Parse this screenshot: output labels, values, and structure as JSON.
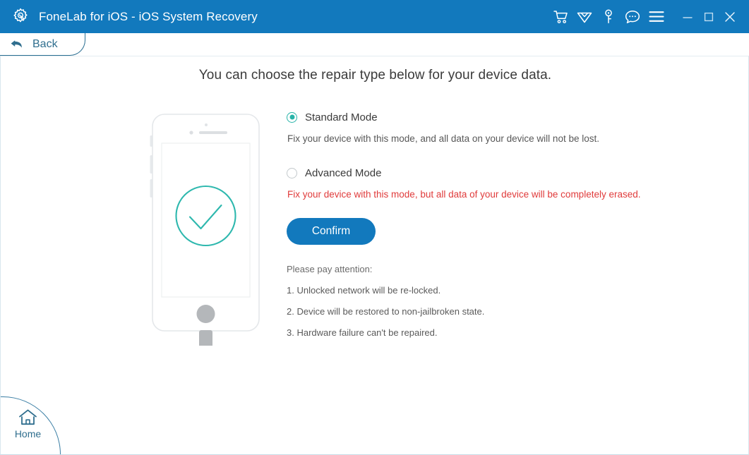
{
  "titlebar": {
    "app_icon": "gear-wrench-icon",
    "title": "FoneLab for iOS - iOS System Recovery",
    "background_color": "#1279bd",
    "actions": [
      {
        "name": "cart-icon",
        "label": "Shopping Cart"
      },
      {
        "name": "diamond-icon",
        "label": "Upgrade"
      },
      {
        "name": "key-icon",
        "label": "Register"
      },
      {
        "name": "chat-icon",
        "label": "Support"
      },
      {
        "name": "menu-icon",
        "label": "Menu"
      }
    ],
    "window_controls": [
      {
        "name": "minimize-icon",
        "label": "Minimize"
      },
      {
        "name": "maximize-icon",
        "label": "Maximize"
      },
      {
        "name": "close-icon",
        "label": "Close"
      }
    ]
  },
  "navigation": {
    "back_label": "Back",
    "back_icon": "back-arrow-icon",
    "home_label": "Home",
    "home_icon": "house-icon"
  },
  "main": {
    "headline": "You can choose the repair type below for your device data.",
    "illustration": {
      "name": "iphone-with-checkmark-illustration",
      "check_color": "#2eb8ae",
      "outline_color": "#e2e5e8"
    },
    "modes": [
      {
        "id": "standard",
        "label": "Standard Mode",
        "description": "Fix your device with this mode, and all data on your device will not be lost.",
        "selected": true,
        "warning": false
      },
      {
        "id": "advanced",
        "label": "Advanced Mode",
        "description": "Fix your device with this mode, but all data of your device will be completely erased.",
        "selected": false,
        "warning": true
      }
    ],
    "confirm_label": "Confirm",
    "attention": {
      "title": "Please pay attention:",
      "items": [
        "1. Unlocked network will be re-locked.",
        "2. Device will be restored to non-jailbroken state.",
        "3. Hardware failure can't be repaired."
      ]
    }
  },
  "colors": {
    "brand_blue": "#1279bd",
    "accent_teal": "#27b3a8",
    "warning_red": "#e03b3b",
    "link_blue": "#2f6e8e"
  }
}
